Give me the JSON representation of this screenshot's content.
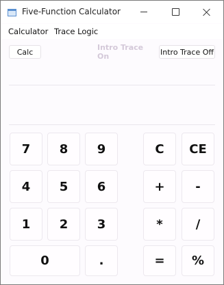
{
  "window": {
    "title": "Five-Function Calculator"
  },
  "menu": {
    "items": [
      "Calculator",
      "Trace Logic"
    ]
  },
  "toolbar": {
    "calc_label": "Calc",
    "intro_on_label": "Intro Trace On",
    "intro_off_label": "Intro Trace Off"
  },
  "display": {
    "value": ""
  },
  "keypad": {
    "k7": "7",
    "k8": "8",
    "k9": "9",
    "kC": "C",
    "kCE": "CE",
    "k4": "4",
    "k5": "5",
    "k6": "6",
    "kPlus": "+",
    "kMinus": "-",
    "k1": "1",
    "k2": "2",
    "k3": "3",
    "kMul": "*",
    "kDiv": "/",
    "k0": "0",
    "kDot": ".",
    "kEq": "=",
    "kPct": "%"
  },
  "colors": {
    "disabled_text": "#d4c9d9",
    "window_bg": "#fdfbfe"
  }
}
